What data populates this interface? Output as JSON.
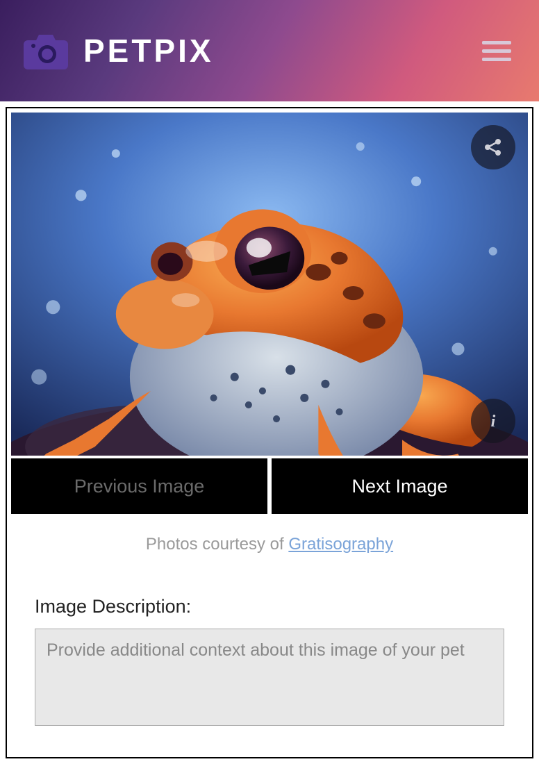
{
  "header": {
    "brand": "PETPIX"
  },
  "nav": {
    "prev_label": "Previous Image",
    "next_label": "Next Image"
  },
  "credit": {
    "prefix": "Photos courtesy of ",
    "link_text": "Gratisography"
  },
  "description": {
    "label": "Image Description:",
    "placeholder": "Provide additional context about this image of your pet",
    "value": ""
  },
  "image": {
    "alt": "Orange and blue frog close-up with water droplets"
  }
}
